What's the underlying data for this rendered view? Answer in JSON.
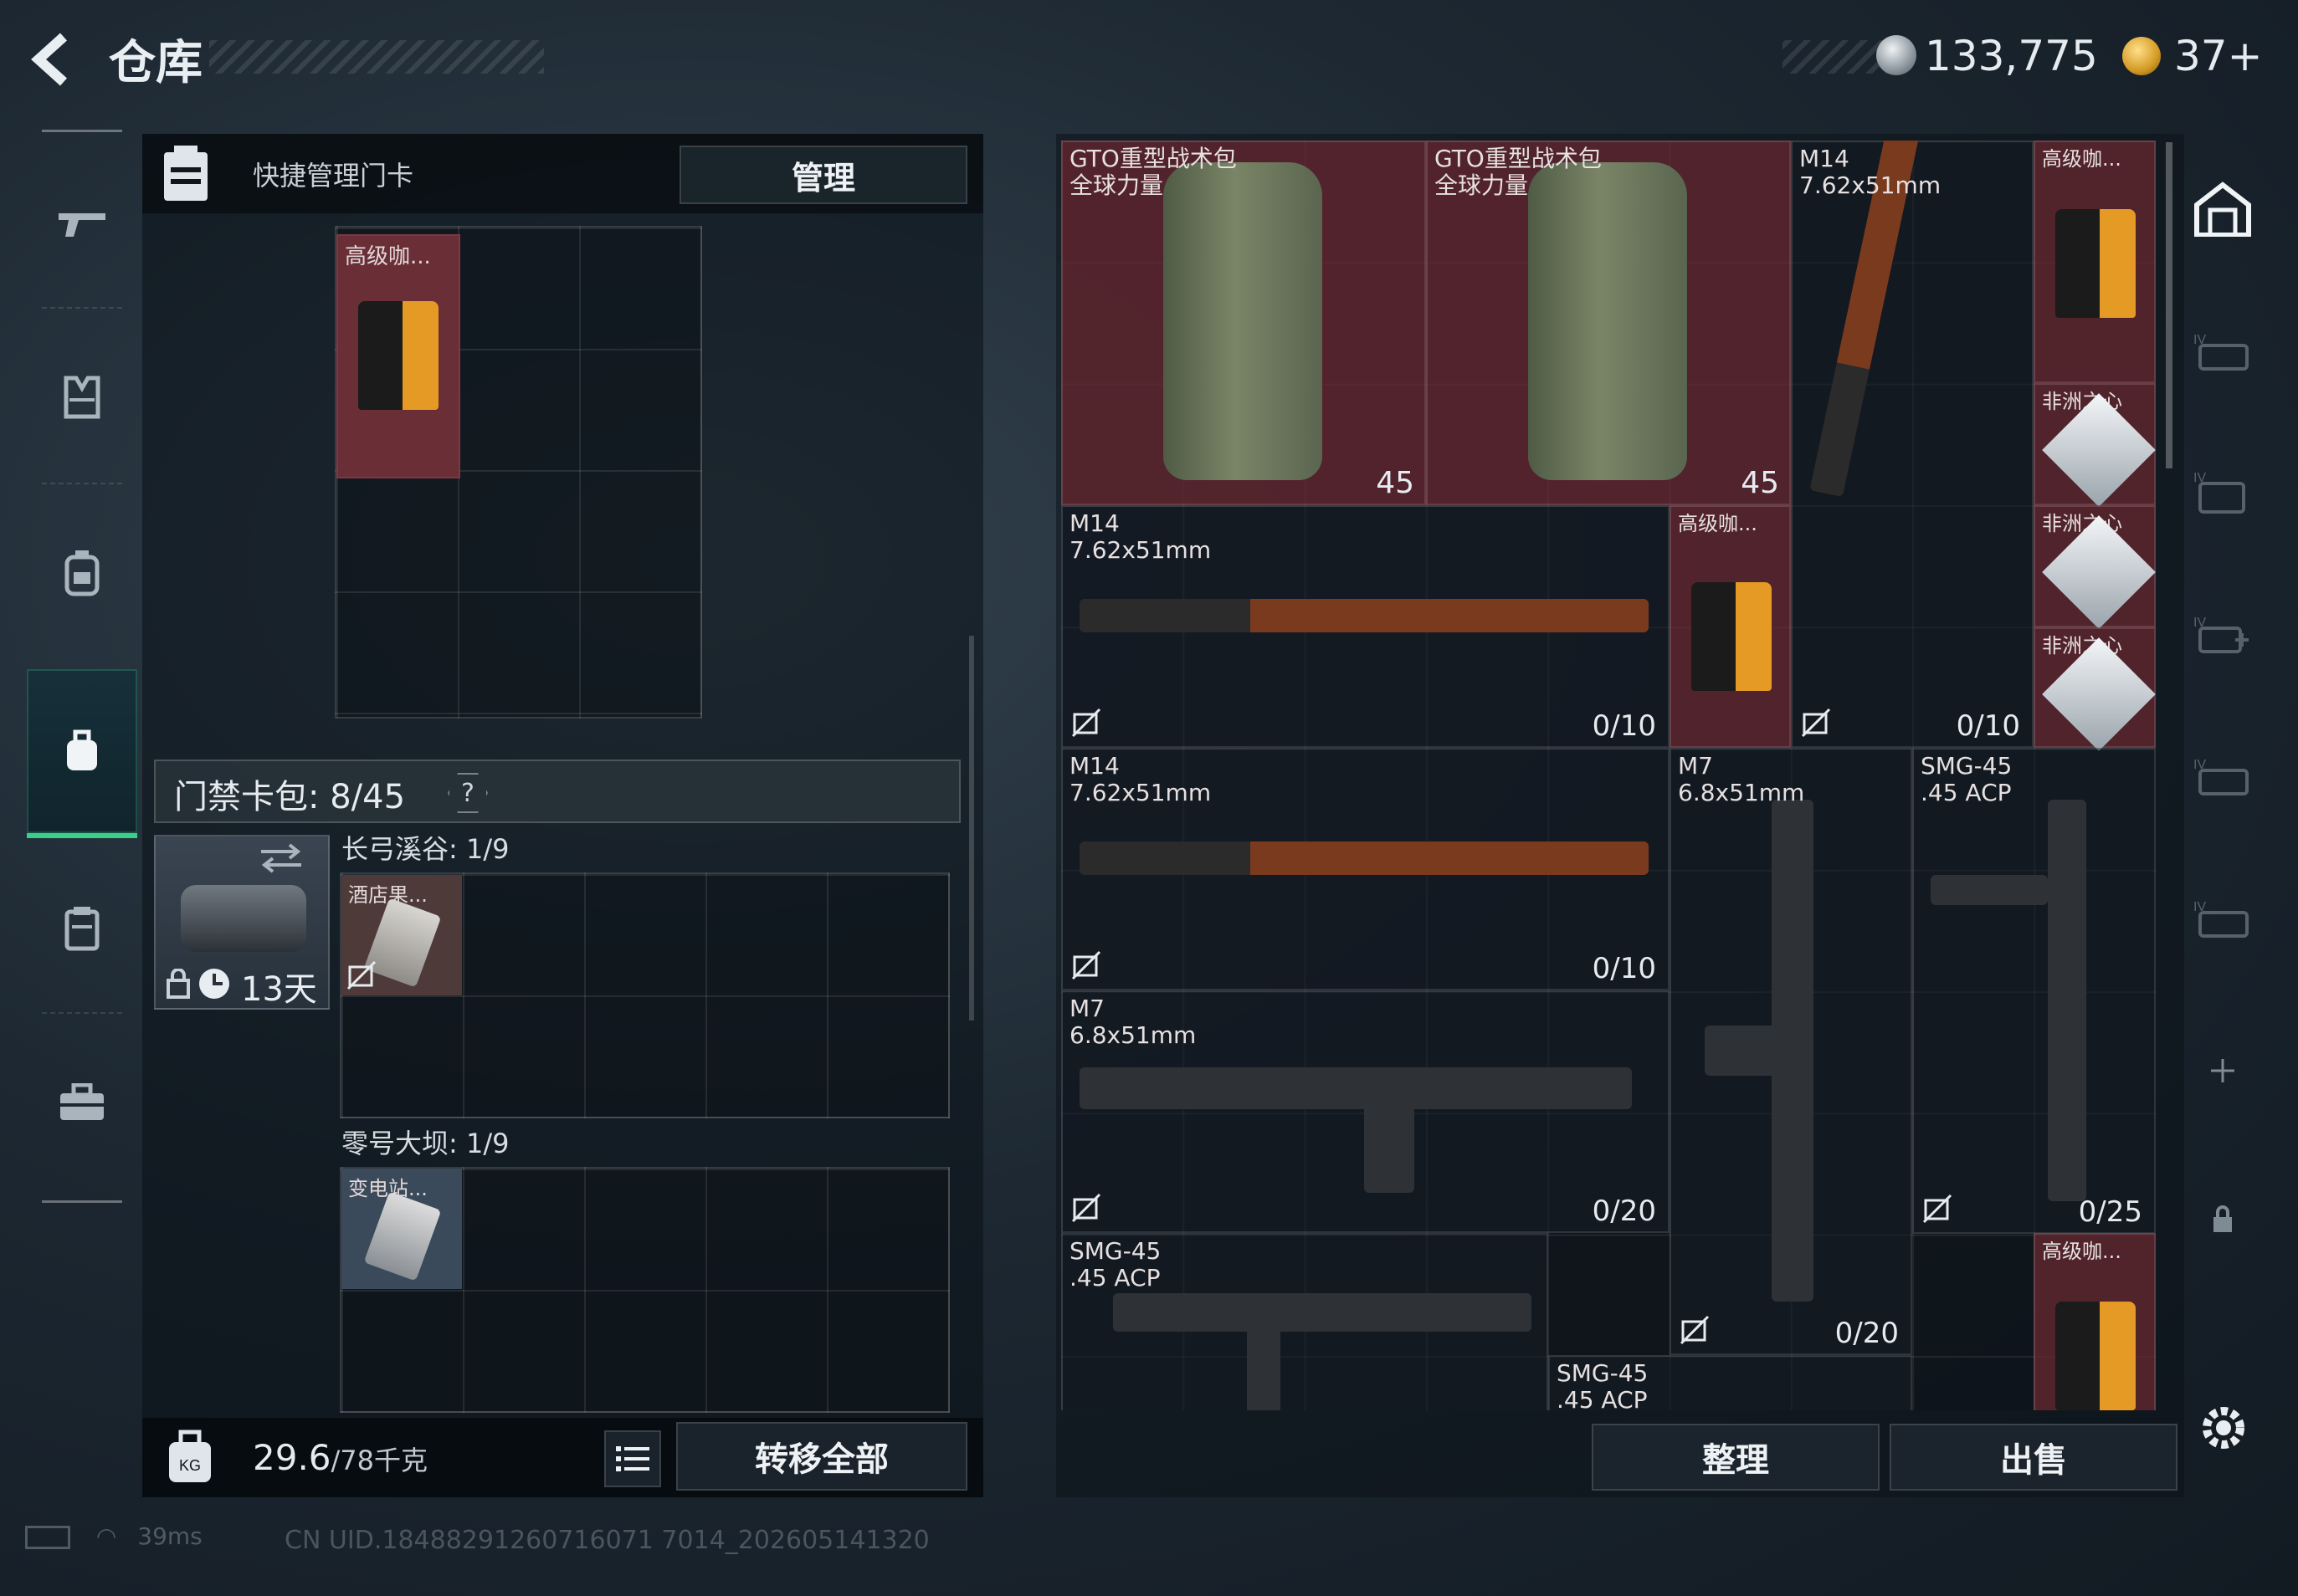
{
  "header": {
    "title": "仓库",
    "coin_a": "133,775",
    "coin_b": "37+"
  },
  "quick_card": {
    "label": "快捷管理门卡",
    "manage_button": "管理",
    "item_label": "高级咖..."
  },
  "card_pack": {
    "label": "门禁卡包: 8/45",
    "help": "?",
    "timer": "13天",
    "sections": [
      {
        "label": "长弓溪谷: 1/9",
        "item_label": "酒店果..."
      },
      {
        "label": "零号大坝: 1/9",
        "item_label": "变电站..."
      }
    ]
  },
  "footer_left": {
    "weight": "29.6",
    "weight_unit": "/78千克",
    "transfer_button": "转移全部"
  },
  "inventory": {
    "items": [
      {
        "name": "GTO重型战术包\n全球力量",
        "count": "45"
      },
      {
        "name": "GTO重型战术包\n全球力量",
        "count": "45"
      },
      {
        "name": "M14\n7.62x51mm",
        "capacity": "0/10"
      },
      {
        "name": "高级咖..."
      },
      {
        "name": "非洲之心"
      },
      {
        "name": "M14\n7.62x51mm",
        "capacity": "0/10"
      },
      {
        "name": "高级咖..."
      },
      {
        "name": "非洲之心"
      },
      {
        "name": "非洲之心"
      },
      {
        "name": "M14\n7.62x51mm",
        "capacity": "0/10"
      },
      {
        "name": "M7\n6.8x51mm",
        "capacity": "0/20"
      },
      {
        "name": "SMG-45\n.45 ACP",
        "capacity": "0/25"
      },
      {
        "name": "M7\n6.8x51mm",
        "capacity": "0/20"
      },
      {
        "name": "SMG-45\n.45 ACP"
      },
      {
        "name": "高级咖..."
      },
      {
        "name": "SMG-45\n.45 ACP"
      }
    ],
    "sort_button": "整理",
    "sell_button": "出售"
  },
  "status": {
    "ping": "39ms",
    "uid": "CN UID.18488291260716071 7014_202605141320"
  },
  "colors": {
    "accent_green": "#3bd08a",
    "item_red": "#682832"
  }
}
